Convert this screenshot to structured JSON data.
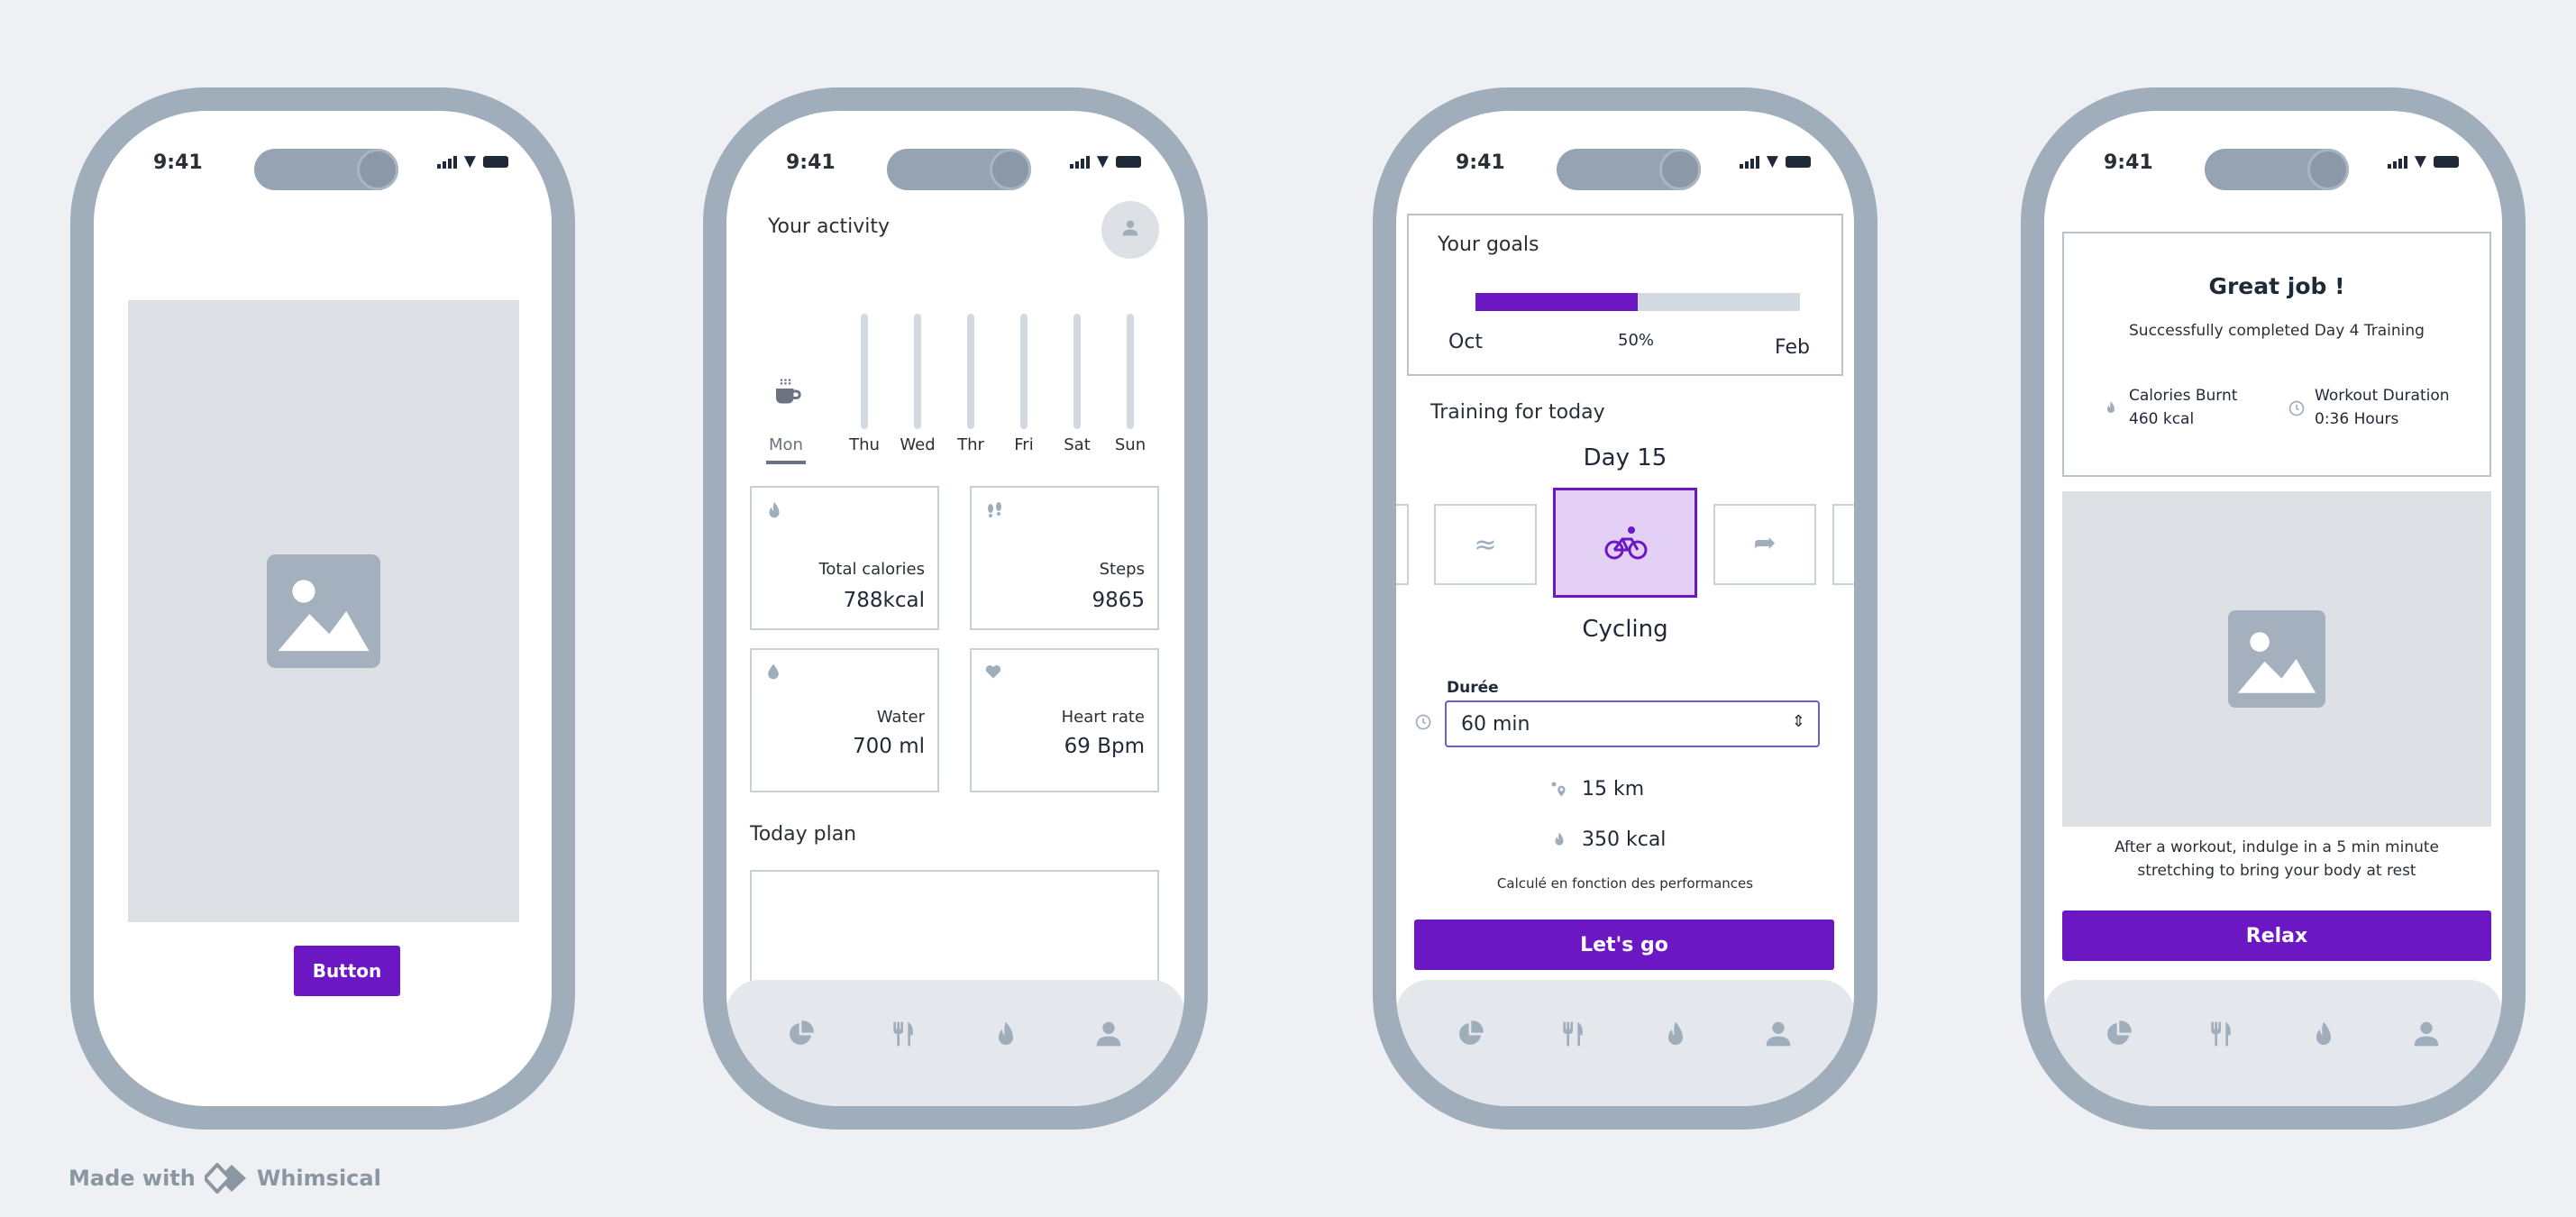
{
  "status": {
    "time": "9:41"
  },
  "screen1": {
    "button_label": "Button"
  },
  "screen2": {
    "title": "Your activity",
    "days": [
      "Mon",
      "Thu",
      "Wed",
      "Thr",
      "Fri",
      "Sat",
      "Sun"
    ],
    "cards": [
      {
        "label": "Total calories",
        "value": "788kcal",
        "icon": "flame-icon"
      },
      {
        "label": "Steps",
        "value": "9865",
        "icon": "footsteps-icon"
      },
      {
        "label": "Water",
        "value": "700 ml",
        "icon": "water-drop-icon"
      },
      {
        "label": "Heart rate",
        "value": "69 Bpm",
        "icon": "heart-icon"
      }
    ],
    "plan_title": "Today plan"
  },
  "screen3": {
    "goals_title": "Your goals",
    "progress": 0.5,
    "progress_label": "50%",
    "start_label": "Oct",
    "end_label": "Feb",
    "training_title": "Training for today",
    "day": "Day 15",
    "activity": "Cycling",
    "duration_label": "Durée",
    "duration_value": "60 min",
    "distance": "15 km",
    "calories": "350 kcal",
    "note": "Calculé en fonction des performances",
    "cta": "Let's go"
  },
  "screen4": {
    "title": "Great job !",
    "subtitle": "Successfully completed  Day 4 Training",
    "calories_label": "Calories Burnt",
    "calories_value": "460 kcal",
    "duration_label": "Workout Duration",
    "duration_value": "0:36 Hours",
    "message": "After a workout, indulge in a 5 min minute stretching to bring your body at rest",
    "cta": "Relax"
  },
  "footer": {
    "made_with": "Made with",
    "brand": "Whimsical"
  },
  "colors": {
    "accent": "#6b17c4",
    "frame": "#a0adbb",
    "placeholder": "#dde1e6"
  }
}
